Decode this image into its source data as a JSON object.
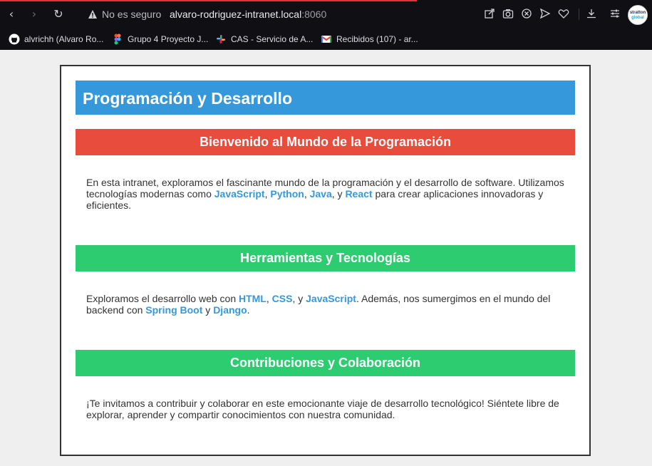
{
  "browser": {
    "insecure_label": "No es seguro",
    "url_host": "alvaro-rodriguez-intranet.local",
    "url_port": ":8060",
    "profile_line1": "stratton",
    "profile_line2": "global"
  },
  "bookmarks": [
    {
      "label": "alvrichh (Alvaro Ro...",
      "icon": "github-icon"
    },
    {
      "label": "Grupo 4 Proyecto J...",
      "icon": "figma-icon"
    },
    {
      "label": "CAS - Servicio de A...",
      "icon": "slack-icon"
    },
    {
      "label": "Recibidos (107) - ar...",
      "icon": "gmail-icon"
    }
  ],
  "page": {
    "title": "Programación y Desarrollo",
    "sections": [
      {
        "heading": "Bienvenido al Mundo de la Programación",
        "color": "#e74c3c",
        "text": [
          "En esta intranet, exploramos el fascinante mundo de la programación y el desarrollo de software. Utilizamos tecnologías modernas como ",
          "JavaScript",
          ", ",
          "Python",
          ", ",
          "Java",
          ", y ",
          "React",
          " para crear aplicaciones innovadoras y eficientes."
        ]
      },
      {
        "heading": "Herramientas y Tecnologías",
        "color": "#2ecc71",
        "text": [
          "Exploramos el desarrollo web con ",
          "HTML",
          ", ",
          "CSS",
          ", y ",
          "JavaScript",
          ". Además, nos sumergimos en el mundo del backend con ",
          "Spring Boot",
          " y ",
          "Django",
          "."
        ]
      },
      {
        "heading": "Contribuciones y Colaboración",
        "color": "#2ecc71",
        "text": [
          "¡Te invitamos a contribuir y colaborar en este emocionante viaje de desarrollo tecnológico! Siéntete libre de explorar, aprender y compartir conocimientos con nuestra comunidad."
        ]
      }
    ]
  },
  "colors": {
    "header_blue": "#3498db",
    "red": "#e74c3c",
    "green": "#2ecc71",
    "link": "#3498db"
  }
}
